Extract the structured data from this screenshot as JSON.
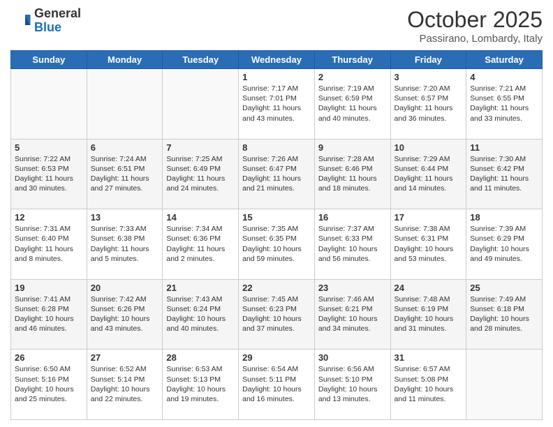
{
  "header": {
    "logo_general": "General",
    "logo_blue": "Blue",
    "month_title": "October 2025",
    "location": "Passirano, Lombardy, Italy"
  },
  "weekdays": [
    "Sunday",
    "Monday",
    "Tuesday",
    "Wednesday",
    "Thursday",
    "Friday",
    "Saturday"
  ],
  "weeks": [
    [
      {
        "day": "",
        "info": ""
      },
      {
        "day": "",
        "info": ""
      },
      {
        "day": "",
        "info": ""
      },
      {
        "day": "1",
        "info": "Sunrise: 7:17 AM\nSunset: 7:01 PM\nDaylight: 11 hours\nand 43 minutes."
      },
      {
        "day": "2",
        "info": "Sunrise: 7:19 AM\nSunset: 6:59 PM\nDaylight: 11 hours\nand 40 minutes."
      },
      {
        "day": "3",
        "info": "Sunrise: 7:20 AM\nSunset: 6:57 PM\nDaylight: 11 hours\nand 36 minutes."
      },
      {
        "day": "4",
        "info": "Sunrise: 7:21 AM\nSunset: 6:55 PM\nDaylight: 11 hours\nand 33 minutes."
      }
    ],
    [
      {
        "day": "5",
        "info": "Sunrise: 7:22 AM\nSunset: 6:53 PM\nDaylight: 11 hours\nand 30 minutes."
      },
      {
        "day": "6",
        "info": "Sunrise: 7:24 AM\nSunset: 6:51 PM\nDaylight: 11 hours\nand 27 minutes."
      },
      {
        "day": "7",
        "info": "Sunrise: 7:25 AM\nSunset: 6:49 PM\nDaylight: 11 hours\nand 24 minutes."
      },
      {
        "day": "8",
        "info": "Sunrise: 7:26 AM\nSunset: 6:47 PM\nDaylight: 11 hours\nand 21 minutes."
      },
      {
        "day": "9",
        "info": "Sunrise: 7:28 AM\nSunset: 6:46 PM\nDaylight: 11 hours\nand 18 minutes."
      },
      {
        "day": "10",
        "info": "Sunrise: 7:29 AM\nSunset: 6:44 PM\nDaylight: 11 hours\nand 14 minutes."
      },
      {
        "day": "11",
        "info": "Sunrise: 7:30 AM\nSunset: 6:42 PM\nDaylight: 11 hours\nand 11 minutes."
      }
    ],
    [
      {
        "day": "12",
        "info": "Sunrise: 7:31 AM\nSunset: 6:40 PM\nDaylight: 11 hours\nand 8 minutes."
      },
      {
        "day": "13",
        "info": "Sunrise: 7:33 AM\nSunset: 6:38 PM\nDaylight: 11 hours\nand 5 minutes."
      },
      {
        "day": "14",
        "info": "Sunrise: 7:34 AM\nSunset: 6:36 PM\nDaylight: 11 hours\nand 2 minutes."
      },
      {
        "day": "15",
        "info": "Sunrise: 7:35 AM\nSunset: 6:35 PM\nDaylight: 10 hours\nand 59 minutes."
      },
      {
        "day": "16",
        "info": "Sunrise: 7:37 AM\nSunset: 6:33 PM\nDaylight: 10 hours\nand 56 minutes."
      },
      {
        "day": "17",
        "info": "Sunrise: 7:38 AM\nSunset: 6:31 PM\nDaylight: 10 hours\nand 53 minutes."
      },
      {
        "day": "18",
        "info": "Sunrise: 7:39 AM\nSunset: 6:29 PM\nDaylight: 10 hours\nand 49 minutes."
      }
    ],
    [
      {
        "day": "19",
        "info": "Sunrise: 7:41 AM\nSunset: 6:28 PM\nDaylight: 10 hours\nand 46 minutes."
      },
      {
        "day": "20",
        "info": "Sunrise: 7:42 AM\nSunset: 6:26 PM\nDaylight: 10 hours\nand 43 minutes."
      },
      {
        "day": "21",
        "info": "Sunrise: 7:43 AM\nSunset: 6:24 PM\nDaylight: 10 hours\nand 40 minutes."
      },
      {
        "day": "22",
        "info": "Sunrise: 7:45 AM\nSunset: 6:23 PM\nDaylight: 10 hours\nand 37 minutes."
      },
      {
        "day": "23",
        "info": "Sunrise: 7:46 AM\nSunset: 6:21 PM\nDaylight: 10 hours\nand 34 minutes."
      },
      {
        "day": "24",
        "info": "Sunrise: 7:48 AM\nSunset: 6:19 PM\nDaylight: 10 hours\nand 31 minutes."
      },
      {
        "day": "25",
        "info": "Sunrise: 7:49 AM\nSunset: 6:18 PM\nDaylight: 10 hours\nand 28 minutes."
      }
    ],
    [
      {
        "day": "26",
        "info": "Sunrise: 6:50 AM\nSunset: 5:16 PM\nDaylight: 10 hours\nand 25 minutes."
      },
      {
        "day": "27",
        "info": "Sunrise: 6:52 AM\nSunset: 5:14 PM\nDaylight: 10 hours\nand 22 minutes."
      },
      {
        "day": "28",
        "info": "Sunrise: 6:53 AM\nSunset: 5:13 PM\nDaylight: 10 hours\nand 19 minutes."
      },
      {
        "day": "29",
        "info": "Sunrise: 6:54 AM\nSunset: 5:11 PM\nDaylight: 10 hours\nand 16 minutes."
      },
      {
        "day": "30",
        "info": "Sunrise: 6:56 AM\nSunset: 5:10 PM\nDaylight: 10 hours\nand 13 minutes."
      },
      {
        "day": "31",
        "info": "Sunrise: 6:57 AM\nSunset: 5:08 PM\nDaylight: 10 hours\nand 11 minutes."
      },
      {
        "day": "",
        "info": ""
      }
    ]
  ]
}
